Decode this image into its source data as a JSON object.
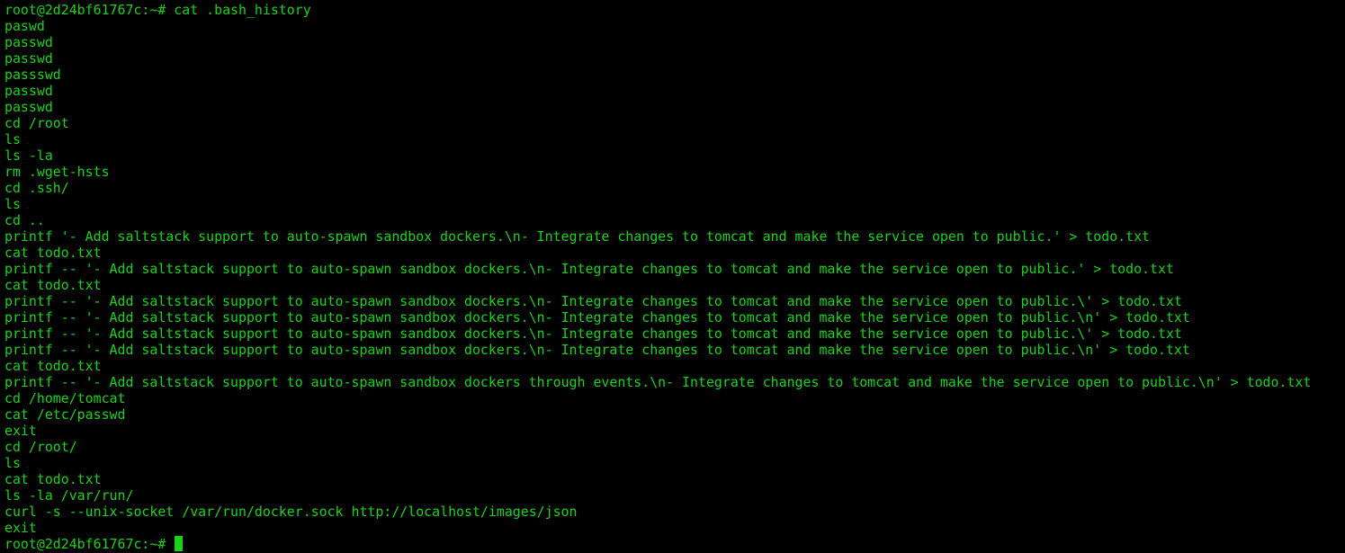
{
  "terminal": {
    "prompt": "root@2d24bf61767c:~#",
    "command": "cat .bash_history",
    "output_lines": [
      "paswd",
      "passwd",
      "passwd",
      "passswd",
      "passwd",
      "passwd",
      "cd /root",
      "ls",
      "ls -la",
      "rm .wget-hsts",
      "cd .ssh/",
      "ls",
      "cd ..",
      "printf '- Add saltstack support to auto-spawn sandbox dockers.\\n- Integrate changes to tomcat and make the service open to public.' > todo.txt",
      "cat todo.txt",
      "printf -- '- Add saltstack support to auto-spawn sandbox dockers.\\n- Integrate changes to tomcat and make the service open to public.' > todo.txt",
      "cat todo.txt",
      "printf -- '- Add saltstack support to auto-spawn sandbox dockers.\\n- Integrate changes to tomcat and make the service open to public.\\' > todo.txt",
      "printf -- '- Add saltstack support to auto-spawn sandbox dockers.\\n- Integrate changes to tomcat and make the service open to public.\\n' > todo.txt",
      "printf -- '- Add saltstack support to auto-spawn sandbox dockers.\\n- Integrate changes to tomcat and make the service open to public.\\' > todo.txt",
      "printf -- '- Add saltstack support to auto-spawn sandbox dockers.\\n- Integrate changes to tomcat and make the service open to public.\\n' > todo.txt",
      "cat todo.txt",
      "printf -- '- Add saltstack support to auto-spawn sandbox dockers through events.\\n- Integrate changes to tomcat and make the service open to public.\\n' > todo.txt",
      "cd /home/tomcat",
      "cat /etc/passwd",
      "exit",
      "cd /root/",
      "ls",
      "cat todo.txt",
      "ls -la /var/run/",
      "curl -s --unix-socket /var/run/docker.sock http://localhost/images/json",
      "exit"
    ],
    "final_prompt": "root@2d24bf61767c:~#",
    "colors": {
      "background": "#000000",
      "foreground": "#16d416",
      "cursor": "#16d416"
    }
  }
}
